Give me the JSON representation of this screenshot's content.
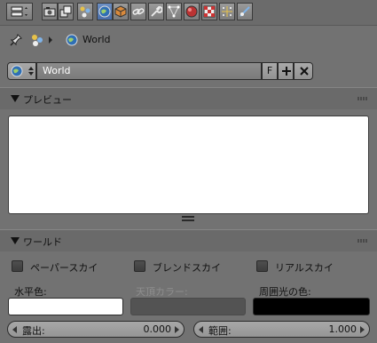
{
  "header": {
    "tabs": [
      {
        "icon": "editor-type-icon"
      },
      {
        "icon": "render-camera-icon"
      },
      {
        "icon": "render-layers-icon"
      },
      {
        "icon": "scene-icon"
      },
      {
        "icon": "world-icon",
        "active": true
      },
      {
        "icon": "object-icon"
      },
      {
        "icon": "constraints-icon"
      },
      {
        "icon": "modifiers-wrench-icon"
      },
      {
        "icon": "object-data-vertices-icon"
      },
      {
        "icon": "material-icon"
      },
      {
        "icon": "texture-icon"
      },
      {
        "icon": "particles-icon"
      },
      {
        "icon": "physics-icon"
      }
    ]
  },
  "breadcrumb": {
    "label": "World"
  },
  "datablock": {
    "name": "World",
    "fake_user": "F"
  },
  "preview_panel": {
    "title": "プレビュー"
  },
  "world_panel": {
    "title": "ワールド",
    "checkboxes": [
      {
        "label": "ペーパースカイ",
        "checked": false
      },
      {
        "label": "ブレンドスカイ",
        "checked": false
      },
      {
        "label": "リアルスカイ",
        "checked": false
      }
    ],
    "color_labels": {
      "horizon": "水平色:",
      "zenith": "天頂カラー:",
      "ambient": "周囲光の色:"
    },
    "colors": {
      "horizon": "#ffffff",
      "zenith": "#535353",
      "ambient": "#000000"
    },
    "exposure": {
      "label": "露出:",
      "value": "0.000"
    },
    "range": {
      "label": "範囲:",
      "value": "1.000"
    }
  },
  "accent_color": "#5680c2"
}
